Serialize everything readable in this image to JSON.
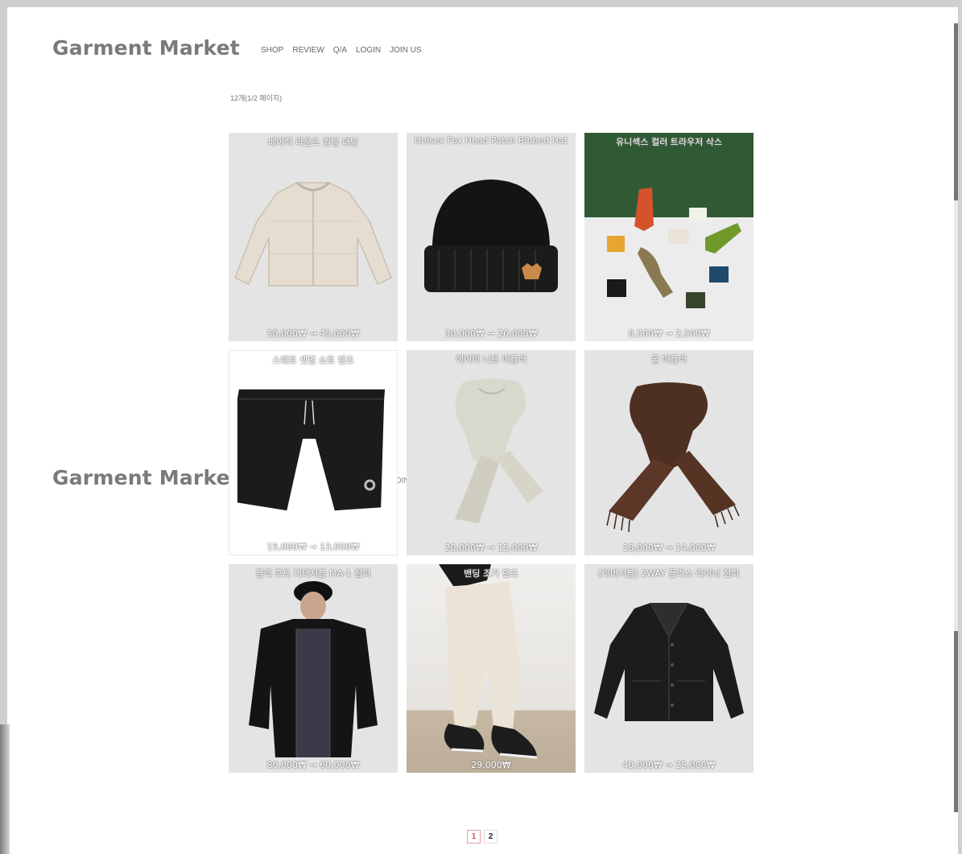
{
  "header": {
    "logo": "Garment Market",
    "nav": [
      "SHOP",
      "REVIEW",
      "Q/A",
      "LOGIN",
      "JOIN US"
    ]
  },
  "ghost": {
    "logo": "Garment Market",
    "nav_fragment": "OIN"
  },
  "product_count": "12개(1/2 페이지)",
  "products": [
    {
      "title": "베이직 라운드 퀼팅 패딩",
      "price": "50,000₩ → 45,000₩",
      "icon": "puffer-jacket"
    },
    {
      "title": "Unisex Fox Head Patch Ribbed Hat",
      "price": "30,000₩ → 20,000₩",
      "icon": "beanie"
    },
    {
      "title": "유니섹스 컬러 트라우저 삭스",
      "price": "8,500₩ → 2,500₩",
      "icon": "socks"
    },
    {
      "title": "스웨트 셋업 쇼트 팬츠",
      "price": "15,000₩ → 13,000₩",
      "icon": "shorts"
    },
    {
      "title": "헤어리 니트 머플러",
      "price": "20,000₩ → 15,000₩",
      "icon": "scarf-light"
    },
    {
      "title": "울 머플러",
      "price": "18,000₩ → 14,000₩",
      "icon": "scarf-brown"
    },
    {
      "title": "블랙 후드 디테처블 MA-1 점퍼",
      "price": "80,000₩ → 60,000₩",
      "icon": "bomber-jacket"
    },
    {
      "title": "밴딩 조거 팬츠",
      "price": "29,000₩",
      "icon": "jogger-pants"
    },
    {
      "title": "[리버서블] 2WAY 플리스 라이너 점퍼",
      "price": "40,000₩ → 25,000₩",
      "icon": "liner-jacket"
    }
  ],
  "pagination": {
    "pages": [
      "1",
      "2"
    ],
    "current": "1"
  }
}
